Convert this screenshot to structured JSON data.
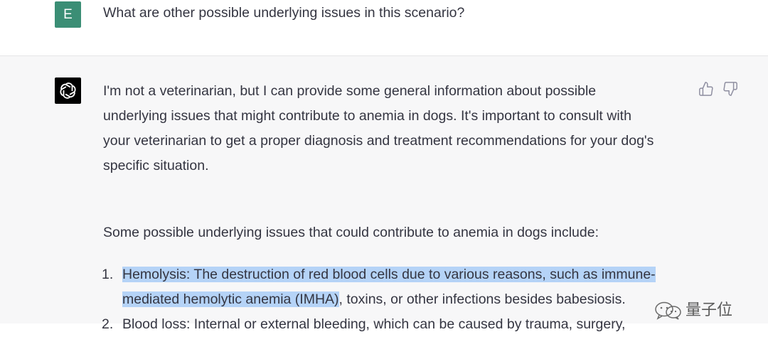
{
  "user_message": {
    "avatar_letter": "E",
    "text": "What are other possible underlying issues in this scenario?"
  },
  "assistant_message": {
    "intro_lines": [
      "I'm not a veterinarian, but I can provide some general information about possible",
      "underlying issues that might contribute to anemia in dogs. It's important to consult with",
      "your veterinarian to get a proper diagnosis and treatment recommendations for your dog's",
      "specific situation."
    ],
    "list_intro": "Some possible underlying issues that could contribute to anemia in dogs include:",
    "items": [
      {
        "number": "1.",
        "line1": "Hemolysis: The destruction of red blood cells due to various reasons, such as immune-",
        "line2_highlighted": "mediated hemolytic anemia (IMHA)",
        "line2_rest": ", toxins, or other infections besides babesiosis."
      },
      {
        "number": "2.",
        "line1": "Blood loss: Internal or external bleeding, which can be caused by trauma, surgery,"
      }
    ]
  },
  "feedback": {
    "thumbs_up_icon": "thumbs-up-icon",
    "thumbs_down_icon": "thumbs-down-icon"
  },
  "watermark": {
    "text": "量子位"
  },
  "colors": {
    "user_avatar": "#3b8e75",
    "assistant_bg": "#f7f7f8",
    "selection_highlight": "#b5d3f7"
  }
}
